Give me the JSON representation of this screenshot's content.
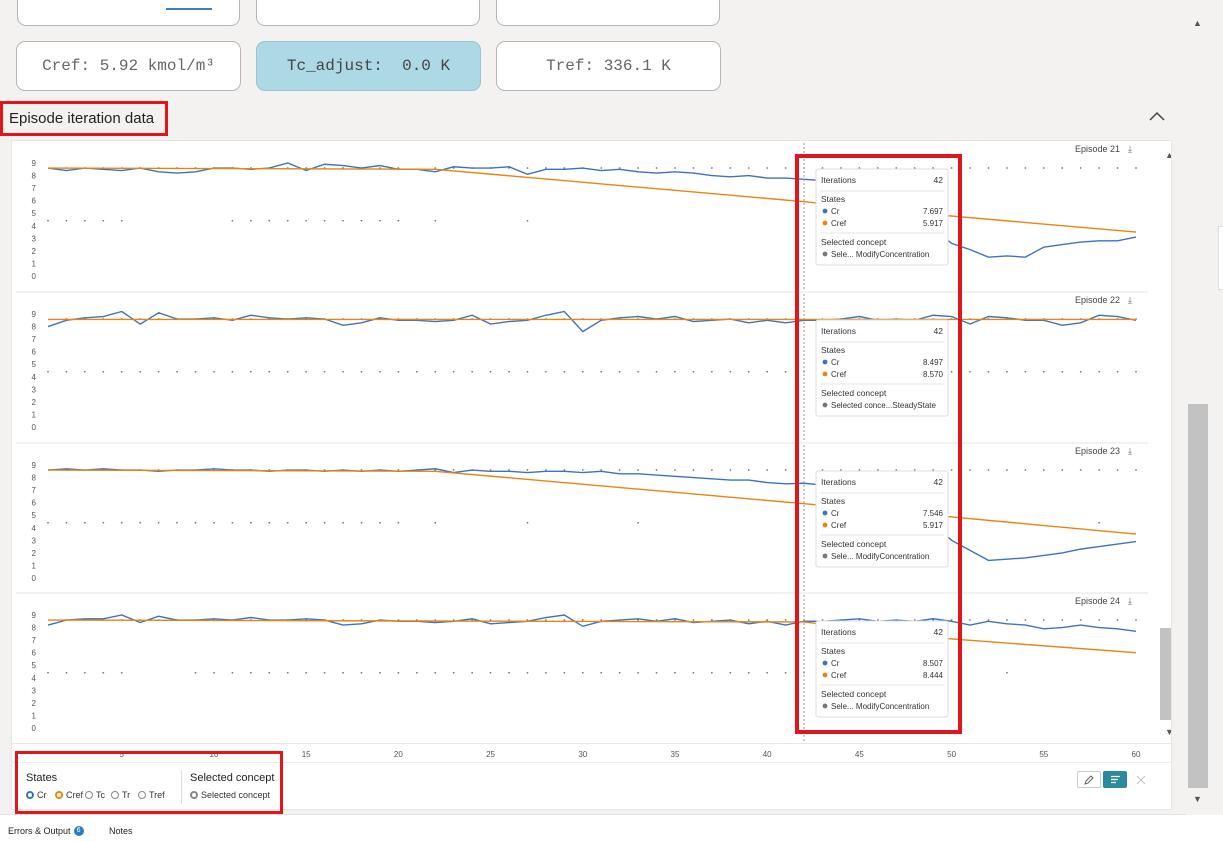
{
  "cards": {
    "cref": "Cref: 5.92 kmol/m³",
    "tc_adjust": "Tc_adjust:  0.0 K",
    "tref": "Tref: 336.1 K"
  },
  "section": {
    "title": "Episode iteration data"
  },
  "tooltip_labels": {
    "iterations": "Iterations",
    "states": "States",
    "selected_concept": "Selected concept"
  },
  "chart_data": [
    {
      "type": "line",
      "title": "Episode 21",
      "ylim": [
        0,
        9
      ],
      "yticks": [
        "9",
        "8",
        "7",
        "6",
        "5",
        "4",
        "3",
        "2",
        "1",
        "0"
      ],
      "series": [
        {
          "name": "Cr",
          "color": "#3a74bf",
          "x": [
            1,
            2,
            3,
            4,
            5,
            6,
            7,
            8,
            9,
            10,
            11,
            12,
            13,
            14,
            15,
            16,
            17,
            18,
            19,
            20,
            21,
            22,
            23,
            24,
            25,
            26,
            27,
            28,
            29,
            30,
            31,
            32,
            33,
            34,
            35,
            36,
            37,
            38,
            39,
            40,
            41,
            42,
            43,
            44,
            45,
            46,
            47,
            48,
            49,
            50,
            51,
            52,
            53,
            54,
            55,
            56,
            57,
            58,
            59,
            60
          ],
          "y": [
            8.6,
            8.4,
            8.6,
            8.5,
            8.4,
            8.6,
            8.3,
            8.2,
            8.3,
            8.6,
            8.6,
            8.5,
            8.6,
            9.0,
            8.4,
            8.9,
            8.8,
            8.6,
            8.8,
            8.5,
            8.5,
            8.3,
            8.7,
            8.6,
            8.6,
            8.7,
            8.1,
            8.5,
            8.5,
            8.6,
            8.4,
            8.5,
            8.3,
            8.2,
            8.3,
            8.2,
            8.0,
            7.9,
            8.0,
            7.8,
            7.8,
            7.697,
            7.6,
            7.5,
            7.4,
            7.3,
            7.2,
            5.1,
            3.8,
            2.6,
            2.1,
            1.5,
            1.6,
            1.5,
            2.3,
            2.5,
            2.7,
            2.8,
            2.8,
            3.1
          ]
        },
        {
          "name": "Cref",
          "color": "#e8850f",
          "x": [
            1,
            22,
            42,
            49,
            60
          ],
          "y": [
            8.6,
            8.5,
            5.917,
            4.9,
            3.5
          ]
        }
      ],
      "tooltip": {
        "iterations": 42,
        "cr": "7.697",
        "cref": "5.917",
        "concept": "Sele... ModifyConcentration"
      }
    },
    {
      "type": "line",
      "title": "Episode 22",
      "ylim": [
        0,
        9
      ],
      "yticks": [
        "9",
        "8",
        "7",
        "6",
        "5",
        "4",
        "3",
        "2",
        "1",
        "0"
      ],
      "series": [
        {
          "name": "Cr",
          "color": "#3a74bf",
          "x": [
            1,
            2,
            3,
            4,
            5,
            6,
            7,
            8,
            9,
            10,
            11,
            12,
            13,
            14,
            15,
            16,
            17,
            18,
            19,
            20,
            21,
            22,
            23,
            24,
            25,
            26,
            27,
            28,
            29,
            30,
            31,
            32,
            33,
            34,
            35,
            36,
            37,
            38,
            39,
            40,
            41,
            42,
            43,
            44,
            45,
            46,
            47,
            48,
            49,
            50,
            51,
            52,
            53,
            54,
            55,
            56,
            57,
            58,
            59,
            60
          ],
          "y": [
            8.0,
            8.5,
            8.7,
            8.8,
            9.2,
            8.2,
            9.1,
            8.6,
            8.6,
            8.7,
            8.5,
            8.9,
            8.7,
            8.6,
            8.7,
            8.6,
            8.1,
            8.3,
            8.7,
            8.5,
            8.5,
            8.4,
            8.5,
            8.9,
            8.2,
            8.4,
            8.5,
            8.9,
            9.2,
            7.6,
            8.5,
            8.7,
            8.8,
            8.6,
            8.8,
            8.4,
            8.5,
            8.6,
            8.3,
            8.5,
            8.3,
            8.497,
            8.5,
            8.6,
            8.8,
            8.5,
            8.6,
            8.5,
            8.9,
            8.8,
            8.2,
            8.8,
            8.7,
            8.5,
            8.5,
            8.1,
            8.3,
            8.9,
            8.8,
            8.5
          ]
        },
        {
          "name": "Cref",
          "color": "#e8850f",
          "x": [
            1,
            60
          ],
          "y": [
            8.57,
            8.57
          ]
        }
      ],
      "tooltip": {
        "iterations": 42,
        "cr": "8.497",
        "cref": "8.570",
        "concept": "Selected conce...SteadyState"
      }
    },
    {
      "type": "line",
      "title": "Episode 23",
      "ylim": [
        0,
        9
      ],
      "yticks": [
        "9",
        "8",
        "7",
        "6",
        "5",
        "4",
        "3",
        "2",
        "1",
        "0"
      ],
      "series": [
        {
          "name": "Cr",
          "color": "#3a74bf",
          "x": [
            1,
            2,
            3,
            4,
            5,
            6,
            7,
            8,
            9,
            10,
            11,
            12,
            13,
            14,
            15,
            16,
            17,
            18,
            19,
            20,
            21,
            22,
            23,
            24,
            25,
            26,
            27,
            28,
            29,
            30,
            31,
            32,
            33,
            34,
            35,
            36,
            37,
            38,
            39,
            40,
            41,
            42,
            43,
            44,
            45,
            46,
            47,
            48,
            49,
            50,
            51,
            52,
            53,
            54,
            55,
            56,
            57,
            58,
            59,
            60
          ],
          "y": [
            8.6,
            8.7,
            8.6,
            8.7,
            8.6,
            8.6,
            8.5,
            8.6,
            8.6,
            8.7,
            8.6,
            8.6,
            8.5,
            8.6,
            8.6,
            8.5,
            8.6,
            8.5,
            8.6,
            8.5,
            8.6,
            8.7,
            8.4,
            8.6,
            8.5,
            8.5,
            8.4,
            8.5,
            8.5,
            8.4,
            8.5,
            8.3,
            8.3,
            8.2,
            8.1,
            8.0,
            7.9,
            7.8,
            7.8,
            7.6,
            7.5,
            7.546,
            7.4,
            7.3,
            7.3,
            7.2,
            7.0,
            5.5,
            4.3,
            3.0,
            2.2,
            1.4,
            1.5,
            1.6,
            1.8,
            2.0,
            2.3,
            2.5,
            2.7,
            2.9
          ]
        },
        {
          "name": "Cref",
          "color": "#e8850f",
          "x": [
            1,
            22,
            42,
            49,
            60
          ],
          "y": [
            8.6,
            8.5,
            5.917,
            5.0,
            3.5
          ]
        }
      ],
      "tooltip": {
        "iterations": 42,
        "cr": "7.546",
        "cref": "5.917",
        "concept": "Sele... ModifyConcentration"
      }
    },
    {
      "type": "line",
      "title": "Episode 24",
      "ylim": [
        0,
        9
      ],
      "yticks": [
        "9",
        "8",
        "7",
        "6",
        "5",
        "4",
        "3",
        "2",
        "1",
        "0"
      ],
      "series": [
        {
          "name": "Cr",
          "color": "#3a74bf",
          "x": [
            1,
            2,
            3,
            4,
            5,
            6,
            7,
            8,
            9,
            10,
            11,
            12,
            13,
            14,
            15,
            16,
            17,
            18,
            19,
            20,
            21,
            22,
            23,
            24,
            25,
            26,
            27,
            28,
            29,
            30,
            31,
            32,
            33,
            34,
            35,
            36,
            37,
            38,
            39,
            40,
            41,
            42,
            43,
            44,
            45,
            46,
            47,
            48,
            49,
            50,
            51,
            52,
            53,
            54,
            55,
            56,
            57,
            58,
            59,
            60
          ],
          "y": [
            8.2,
            8.6,
            8.7,
            8.7,
            9.0,
            8.4,
            8.9,
            8.6,
            8.6,
            8.7,
            8.6,
            8.8,
            8.6,
            8.6,
            8.7,
            8.6,
            8.2,
            8.3,
            8.6,
            8.5,
            8.5,
            8.4,
            8.5,
            8.7,
            8.3,
            8.4,
            8.5,
            8.8,
            9.0,
            8.1,
            8.5,
            8.6,
            8.7,
            8.5,
            8.7,
            8.4,
            8.5,
            8.6,
            8.3,
            8.5,
            8.2,
            8.507,
            8.5,
            8.6,
            8.7,
            8.5,
            8.6,
            8.5,
            8.7,
            8.5,
            8.2,
            8.5,
            8.3,
            8.2,
            7.9,
            8.0,
            8.2,
            8.0,
            7.9,
            7.7
          ]
        },
        {
          "name": "Cref",
          "color": "#e8850f",
          "x": [
            1,
            42,
            49,
            60
          ],
          "y": [
            8.6,
            8.444,
            7.2,
            6.0
          ]
        }
      ],
      "tooltip": {
        "iterations": 42,
        "cr": "8.507",
        "cref": "8.444",
        "concept": "Sele... ModifyConcentration"
      }
    }
  ],
  "xaxis": {
    "ticks": [
      "5",
      "10",
      "15",
      "20",
      "25",
      "30",
      "35",
      "40",
      "45",
      "50",
      "55",
      "60"
    ],
    "xlim": [
      1,
      60
    ]
  },
  "legend": {
    "states_title": "States",
    "states": [
      {
        "label": "Cr",
        "checked": true,
        "color": "#3a74bf"
      },
      {
        "label": "Cref",
        "checked": true,
        "color": "#e8850f"
      },
      {
        "label": "Tc",
        "checked": false,
        "color": "#888888"
      },
      {
        "label": "Tr",
        "checked": false,
        "color": "#888888"
      },
      {
        "label": "Tref",
        "checked": false,
        "color": "#888888"
      }
    ],
    "concept_title": "Selected concept",
    "concept_item": "Selected concept"
  },
  "bottom_tabs": {
    "errors": "Errors & Output",
    "errors_count": "6",
    "notes": "Notes"
  },
  "colors": {
    "accent": "#2c8a9e",
    "highlight": "#e3151a",
    "cr": "#3a74bf",
    "cref": "#e8850f"
  }
}
